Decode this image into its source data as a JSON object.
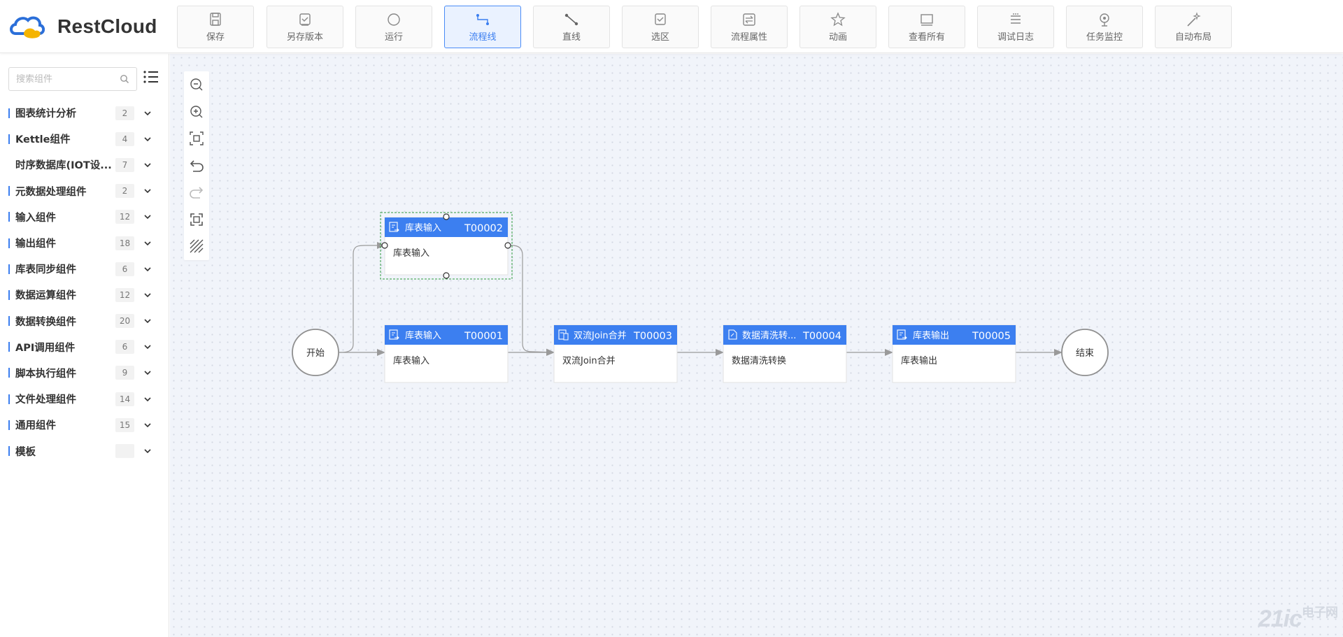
{
  "brand": {
    "name": "RestCloud",
    "colors": {
      "blue": "#2b6fd9",
      "yellow": "#f5b400"
    }
  },
  "toolbar": [
    {
      "label": "保存",
      "icon": "save-icon"
    },
    {
      "label": "另存版本",
      "icon": "save-as-icon"
    },
    {
      "label": "运行",
      "icon": "run-icon"
    },
    {
      "label": "流程线",
      "icon": "flow-line-icon",
      "active": true
    },
    {
      "label": "直线",
      "icon": "straight-line-icon"
    },
    {
      "label": "选区",
      "icon": "selection-icon"
    },
    {
      "label": "流程属性",
      "icon": "flow-properties-icon"
    },
    {
      "label": "动画",
      "icon": "animation-icon"
    },
    {
      "label": "查看所有",
      "icon": "view-all-icon"
    },
    {
      "label": "调试日志",
      "icon": "debug-log-icon"
    },
    {
      "label": "任务监控",
      "icon": "task-monitor-icon"
    },
    {
      "label": "自动布局",
      "icon": "auto-layout-icon"
    }
  ],
  "search": {
    "placeholder": "搜索组件",
    "value": ""
  },
  "categories": [
    {
      "label": "图表统计分析",
      "count": "2",
      "bar": true
    },
    {
      "label": "Kettle组件",
      "count": "4",
      "bar": true
    },
    {
      "label": "时序数据库(IOT设...",
      "count": "7",
      "bar": false
    },
    {
      "label": "元数据处理组件",
      "count": "2",
      "bar": true
    },
    {
      "label": "输入组件",
      "count": "12",
      "bar": true
    },
    {
      "label": "输出组件",
      "count": "18",
      "bar": true
    },
    {
      "label": "库表同步组件",
      "count": "6",
      "bar": true
    },
    {
      "label": "数据运算组件",
      "count": "12",
      "bar": true
    },
    {
      "label": "数据转换组件",
      "count": "20",
      "bar": true
    },
    {
      "label": "API调用组件",
      "count": "6",
      "bar": true
    },
    {
      "label": "脚本执行组件",
      "count": "9",
      "bar": true
    },
    {
      "label": "文件处理组件",
      "count": "14",
      "bar": true
    },
    {
      "label": "通用组件",
      "count": "15",
      "bar": true
    },
    {
      "label": "模板",
      "count": "",
      "bar": true
    }
  ],
  "canvas_tools": [
    "zoom-out-icon",
    "zoom-in-icon",
    "fit-view-icon",
    "undo-icon",
    "redo-icon",
    "actual-size-icon",
    "grid-toggle-icon"
  ],
  "flow": {
    "start": "开始",
    "end": "结束",
    "nodes": {
      "t2": {
        "title": "库表输入",
        "id": "T00002",
        "body": "库表输入",
        "icon": "table-input-icon",
        "selected": true
      },
      "t1": {
        "title": "库表输入",
        "id": "T00001",
        "body": "库表输入",
        "icon": "table-input-icon"
      },
      "t3": {
        "title": "双流Join合并",
        "id": "T00003",
        "body": "双流Join合并",
        "icon": "join-icon"
      },
      "t4": {
        "title": "数据清洗转...",
        "id": "T00004",
        "body": "数据清洗转换",
        "icon": "clean-transform-icon"
      },
      "t5": {
        "title": "库表输出",
        "id": "T00005",
        "body": "库表输出",
        "icon": "table-output-icon"
      }
    },
    "colors": {
      "header": "#3c7ff0",
      "edge": "#9a9a9a",
      "selection": "#2e9b3f"
    }
  },
  "watermark": {
    "main": "21ic",
    "sub": "电子网"
  }
}
